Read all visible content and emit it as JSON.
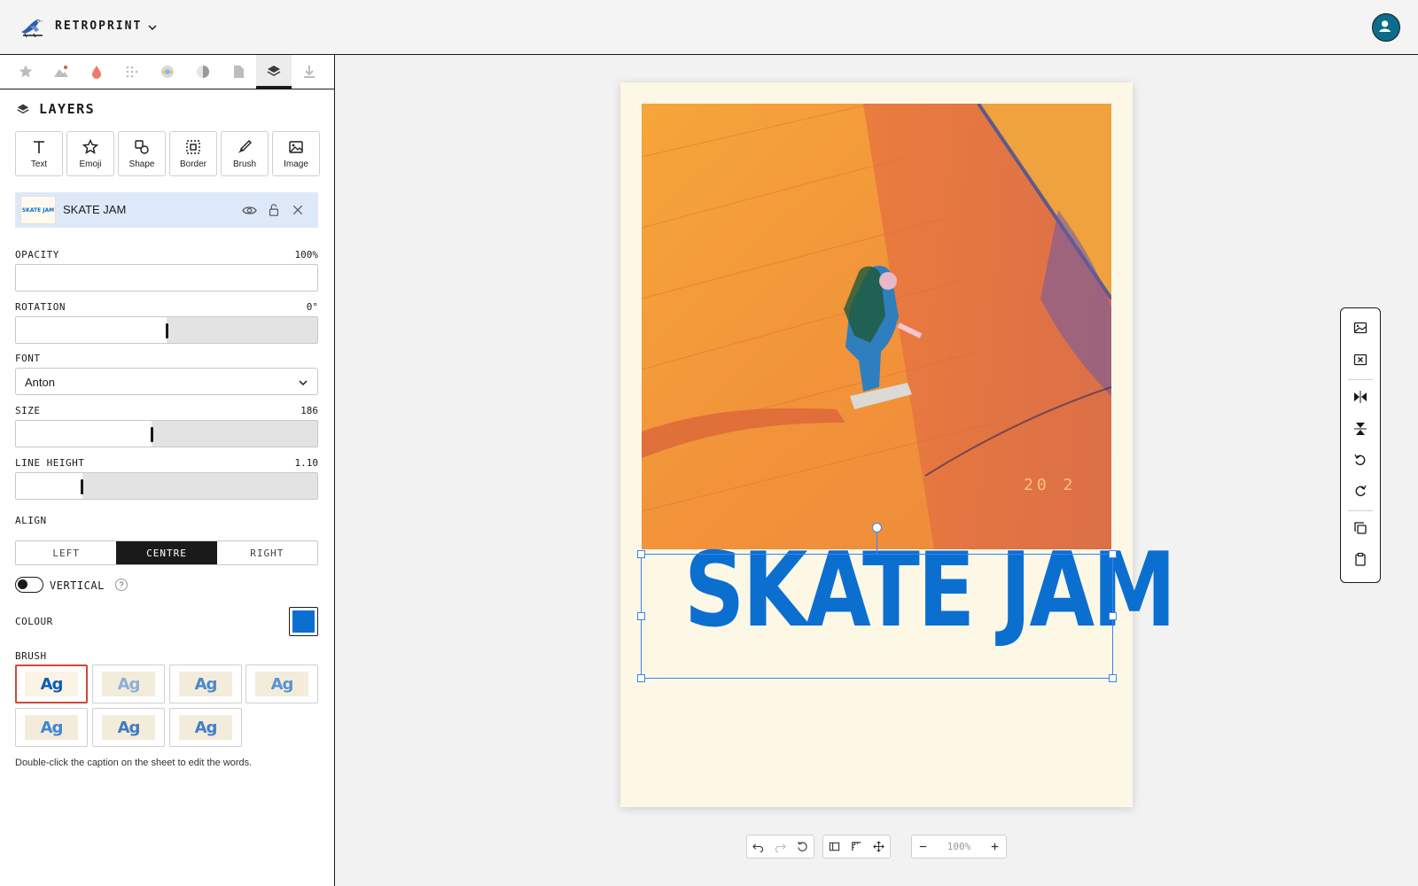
{
  "app": {
    "name": "RETROPRINT"
  },
  "tabs": [
    "favourites",
    "adjust",
    "colour",
    "grain",
    "filters",
    "tone",
    "paper",
    "layers",
    "export"
  ],
  "panel": {
    "title": "LAYERS",
    "tools": [
      {
        "label": "Text",
        "icon": "text-icon"
      },
      {
        "label": "Emoji",
        "icon": "star-icon"
      },
      {
        "label": "Shape",
        "icon": "shapes-icon"
      },
      {
        "label": "Border",
        "icon": "border-icon"
      },
      {
        "label": "Brush",
        "icon": "brush-icon"
      },
      {
        "label": "Image",
        "icon": "image-icon"
      }
    ],
    "layer": {
      "name": "SKATE JAM",
      "thumb_text": "SKATE JAM"
    }
  },
  "props": {
    "opacity": {
      "label": "OPACITY",
      "value": "100%",
      "fraction": 1.0
    },
    "rotation": {
      "label": "ROTATION",
      "value": "0°",
      "fraction": 0.5
    },
    "font": {
      "label": "FONT",
      "value": "Anton"
    },
    "size": {
      "label": "SIZE",
      "value": "186",
      "fraction": 0.45
    },
    "line_height": {
      "label": "LINE HEIGHT",
      "value": "1.10",
      "fraction": 0.22
    },
    "align": {
      "label": "ALIGN",
      "options": [
        "LEFT",
        "CENTRE",
        "RIGHT"
      ],
      "selected": "CENTRE"
    },
    "vertical": {
      "label": "VERTICAL",
      "on": false,
      "help": "?"
    },
    "colour": {
      "label": "COLOUR",
      "value": "#0b6fd0"
    },
    "brush": {
      "label": "BRUSH",
      "sample": "Ag",
      "count": 7,
      "selected_index": 0
    }
  },
  "hint": "Double-click the caption on the sheet to edit the words.",
  "canvas": {
    "caption": "SKATE JAM",
    "caption_color": "#0b6fd0",
    "photo_stamp": "20  2"
  },
  "zoom": {
    "value": "100%"
  },
  "colors": {
    "accent": "#0b6fd0",
    "selected_brush_border": "#d2473a",
    "avatar": "#0b6d8a"
  }
}
